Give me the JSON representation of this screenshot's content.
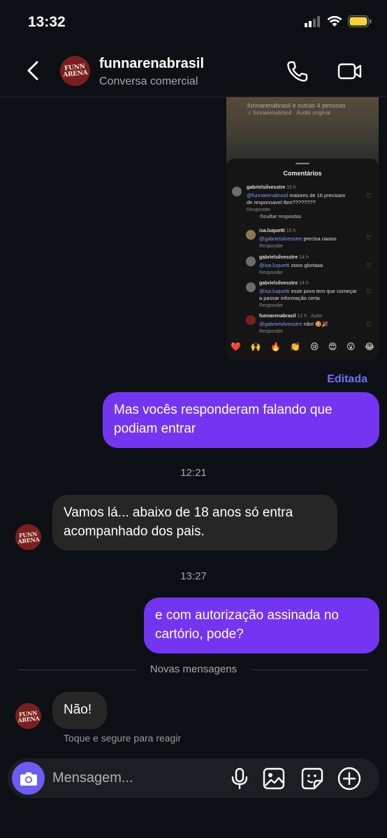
{
  "status": {
    "time": "13:32"
  },
  "header": {
    "title": "funnarenabrasil",
    "subtitle": "Conversa comercial",
    "avatar_text": "FUNN ARENA"
  },
  "shared_post": {
    "top_line1": "funnarenabrasil e outras 4 pessoas",
    "top_line2": "♫ funnarenabrasil · Áudio original",
    "sheet_title": "Comentários",
    "comments": [
      {
        "user": "gabrielsilvesstre",
        "time": "15 h",
        "mention": "@funnarenabrasil",
        "text": " maiores de 16 precisam de responsavel tbm????????",
        "reply": "Responder"
      },
      {
        "user": "isa.luquetti",
        "time": "15 h",
        "mention": "@gabrielsilvesstre",
        "text": " precisa naooo",
        "reply": "Responder"
      },
      {
        "user": "gabrielsilvesstre",
        "time": "14 h",
        "mention": "@isa.luquetti",
        "text": " oooo gloriaaa",
        "reply": "Responder"
      },
      {
        "user": "gabrielsilvesstre",
        "time": "14 h",
        "mention": "@isa.luquetti",
        "text": " esse povo tem que começar a passar informação certa",
        "reply": "Responder"
      },
      {
        "user": "funnarenabrasil",
        "time": "12 h · Autor",
        "mention": "@gabrielsilvesstre",
        "text": " não! 🤩🎉",
        "reply": "Responder"
      }
    ],
    "hide_replies": "Ocultar respostas",
    "emojis": [
      "❤️",
      "🙌",
      "🔥",
      "👏",
      "😢",
      "😍",
      "😮",
      "😂"
    ]
  },
  "messages": {
    "edited_label": "Editada",
    "msg1": "Mas vocês responderam falando que podiam entrar",
    "time1": "12:21",
    "msg2": "Vamos lá... abaixo de 18 anos só entra acompanhado dos pais.",
    "time2": "13:27",
    "msg3": "e com autorização assinada no cartório, pode?",
    "new_messages_label": "Novas mensagens",
    "msg4": "Não!",
    "react_hint": "Toque e segure para reagir"
  },
  "composer": {
    "placeholder": "Mensagem..."
  },
  "colors": {
    "accent": "#7435f2",
    "bubble_in": "#262626",
    "background": "#0c1014",
    "edited": "#6e6ff7"
  }
}
